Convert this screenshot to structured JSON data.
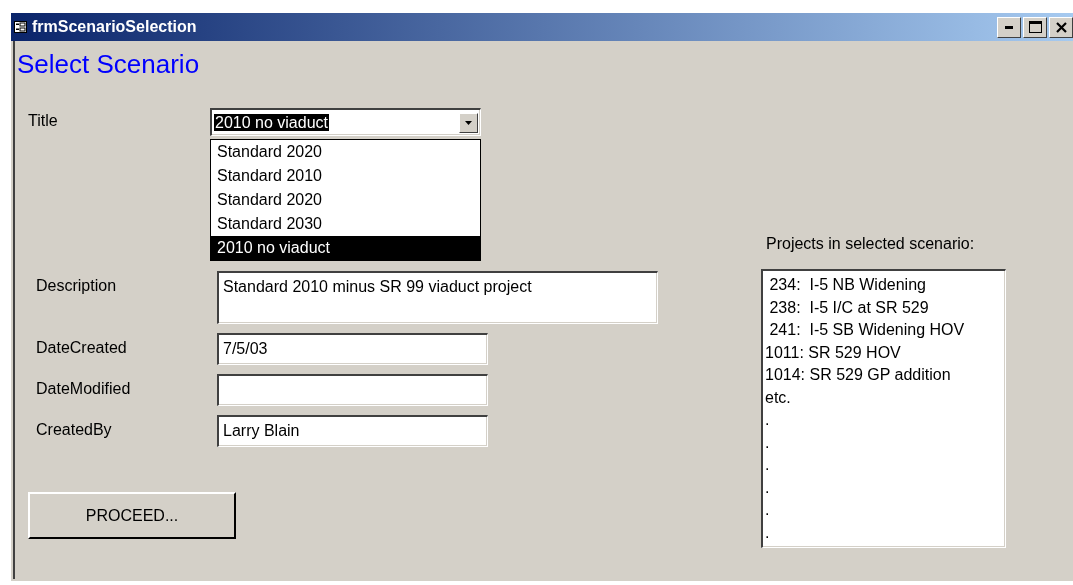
{
  "window": {
    "title": "frmScenarioSelection"
  },
  "heading": "Select Scenario",
  "title_field": {
    "label": "Title",
    "value": "2010 no viaduct",
    "value_highlighted": true,
    "expanded": true,
    "options": [
      {
        "label": "Standard 2020",
        "selected": false
      },
      {
        "label": "Standard 2010",
        "selected": false
      },
      {
        "label": "Standard 2020",
        "selected": false
      },
      {
        "label": "Standard 2030",
        "selected": false
      },
      {
        "label": "2010 no viaduct",
        "selected": true
      }
    ]
  },
  "fields": [
    {
      "label": "Description",
      "value": "Standard 2010 minus SR 99 viaduct project",
      "kind": "multiline"
    },
    {
      "label": "DateCreated",
      "value": "7/5/03",
      "kind": "single"
    },
    {
      "label": "DateModified",
      "kind": "single"
    },
    {
      "label": "CreatedBy",
      "value": "Larry Blain",
      "kind": "single"
    }
  ],
  "proceed_button": "PROCEED...",
  "projects": {
    "label": "Projects in selected scenario:",
    "lines": [
      " 234:  I-5 NB Widening",
      " 238:  I-5 I/C at SR 529",
      " 241:  I-5 SB Widening HOV",
      "1011: SR 529 HOV",
      "1014: SR 529 GP addition",
      "etc.",
      ".",
      ".",
      ".",
      ".",
      ".",
      "."
    ]
  }
}
